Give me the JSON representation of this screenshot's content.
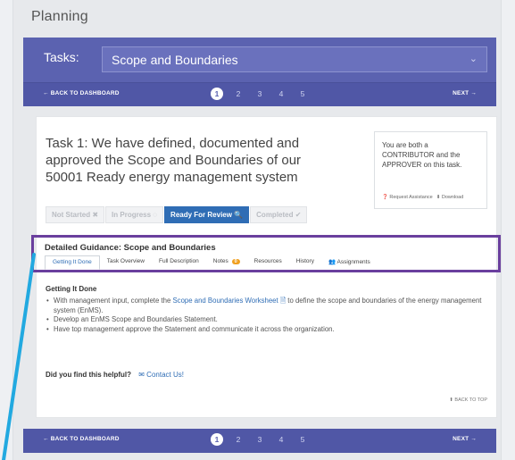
{
  "page": {
    "title": "Planning"
  },
  "tasks": {
    "label": "Tasks:",
    "selected": "Scope and Boundaries"
  },
  "nav": {
    "back": "← BACK TO DASHBOARD",
    "next": "NEXT →",
    "steps": [
      "1",
      "2",
      "3",
      "4",
      "5"
    ],
    "active_step": 1
  },
  "task": {
    "title": "Task 1: We have defined, documented and approved the Scope and Boundaries of our 50001 Ready energy management system",
    "role_text": "You are both a CONTRIBUTOR and the APPROVER on this task.",
    "request_assistance": "Request Assistance",
    "download": "Download"
  },
  "statuses": [
    {
      "label": "Not Started ✖",
      "active": false
    },
    {
      "label": "In Progress ◌",
      "active": false
    },
    {
      "label": "Ready For Review 🔍",
      "active": true
    },
    {
      "label": "Completed ✔",
      "active": false
    }
  ],
  "guidance": {
    "title": "Detailed Guidance: Scope and Boundaries",
    "tabs": [
      {
        "label": "Getting It Done",
        "active": true
      },
      {
        "label": "Task Overview",
        "active": false
      },
      {
        "label": "Full Description",
        "active": false
      },
      {
        "label": "Notes",
        "badge": "0",
        "active": false
      },
      {
        "label": "Resources",
        "active": false
      },
      {
        "label": "History",
        "active": false
      },
      {
        "label": "Assignments",
        "active": false
      }
    ]
  },
  "content": {
    "section_title": "Getting It Done",
    "bullet1_pre": "With management input, complete the ",
    "bullet1_link": "Scope and Boundaries Worksheet",
    "bullet1_post": " to define the scope and boundaries of the energy management system (EnMS).",
    "bullet2": "Develop an EnMS Scope and Boundaries Statement.",
    "bullet3": "Have top management approve the Statement and communicate it across the organization.",
    "helpful": "Did you find this helpful?",
    "contact": "Contact Us!",
    "back_to_top": "BACK TO TOP"
  },
  "colors": {
    "header_bg": "#5b62b0",
    "primary_blue": "#2f6db5",
    "callout_purple": "#6a3f9e",
    "callout_line": "#22a9e0"
  }
}
